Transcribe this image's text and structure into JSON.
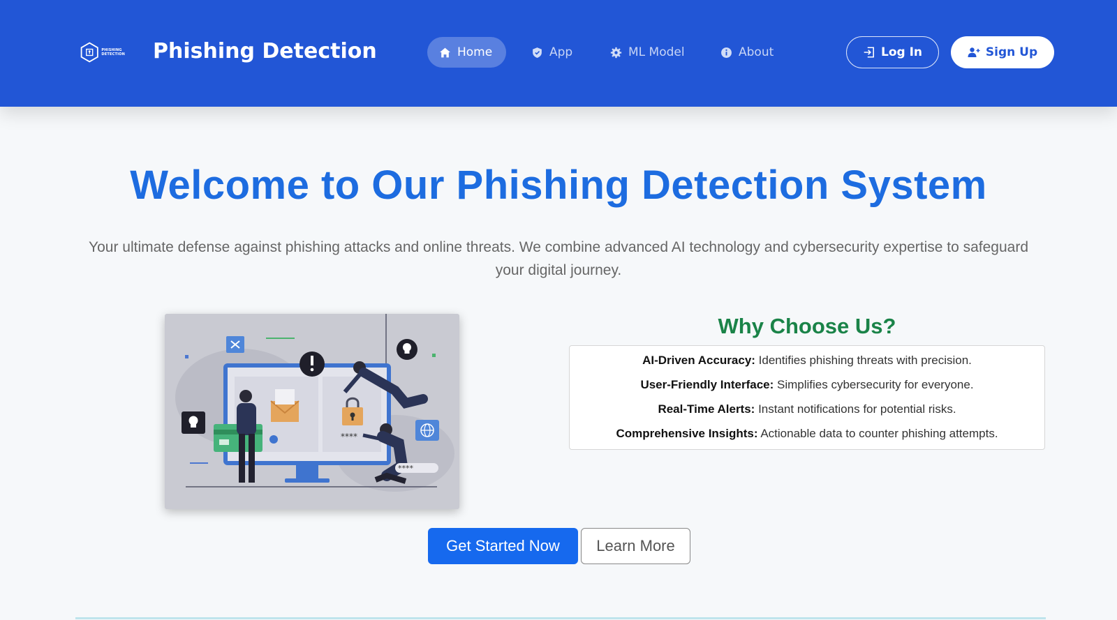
{
  "nav": {
    "logo_text_1": "PHISHING",
    "logo_text_2": "DETECTION",
    "brand": "Phishing Detection",
    "links": [
      {
        "label": "Home",
        "icon": "home-icon",
        "active": true
      },
      {
        "label": "App",
        "icon": "shield-icon",
        "active": false
      },
      {
        "label": "ML Model",
        "icon": "gear-icon",
        "active": false
      },
      {
        "label": "About",
        "icon": "info-icon",
        "active": false
      }
    ],
    "login_label": "Log In",
    "signup_label": "Sign Up"
  },
  "hero": {
    "title": "Welcome to Our Phishing Detection System",
    "subtitle": "Your ultimate defense against phishing attacks and online threats. We combine advanced AI technology and cybersecurity expertise to safeguard your digital journey."
  },
  "why": {
    "title": "Why Choose Us?",
    "items": [
      {
        "label": "AI-Driven Accuracy:",
        "text": " Identifies phishing threats with precision."
      },
      {
        "label": "User-Friendly Interface:",
        "text": " Simplifies cybersecurity for everyone."
      },
      {
        "label": "Real-Time Alerts:",
        "text": " Instant notifications for potential risks."
      },
      {
        "label": "Comprehensive Insights:",
        "text": " Actionable data to counter phishing attempts."
      }
    ]
  },
  "cta": {
    "primary_label": "Get Started Now",
    "secondary_label": "Learn More"
  },
  "illustration": {
    "password_mask_1": "****",
    "password_mask_2": "****"
  },
  "colors": {
    "navbar": "#2256d6",
    "title_blue": "#1d6ce0",
    "why_green": "#1a8348",
    "primary_button": "#1669ee"
  }
}
